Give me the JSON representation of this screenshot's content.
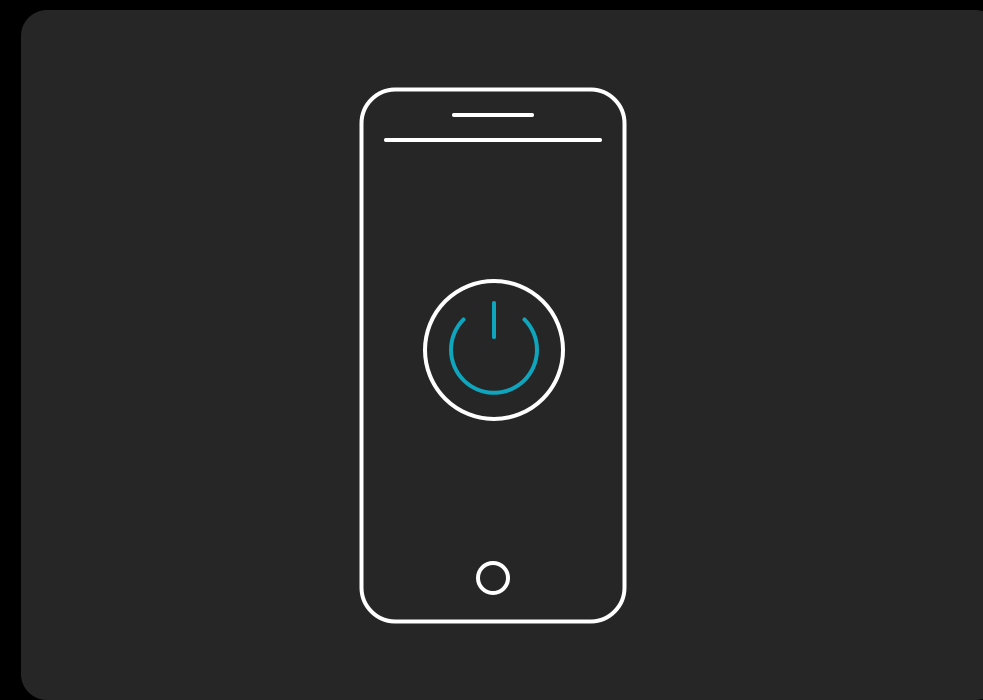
{
  "colors": {
    "page_background": "#000000",
    "card_background": "#262626",
    "outline": "#ffffff",
    "accent": "#0ea5bd"
  },
  "illustration": {
    "device": "smartphone",
    "icons": [
      "smartphone-icon",
      "power-icon",
      "home-button-icon"
    ],
    "state": "power"
  }
}
